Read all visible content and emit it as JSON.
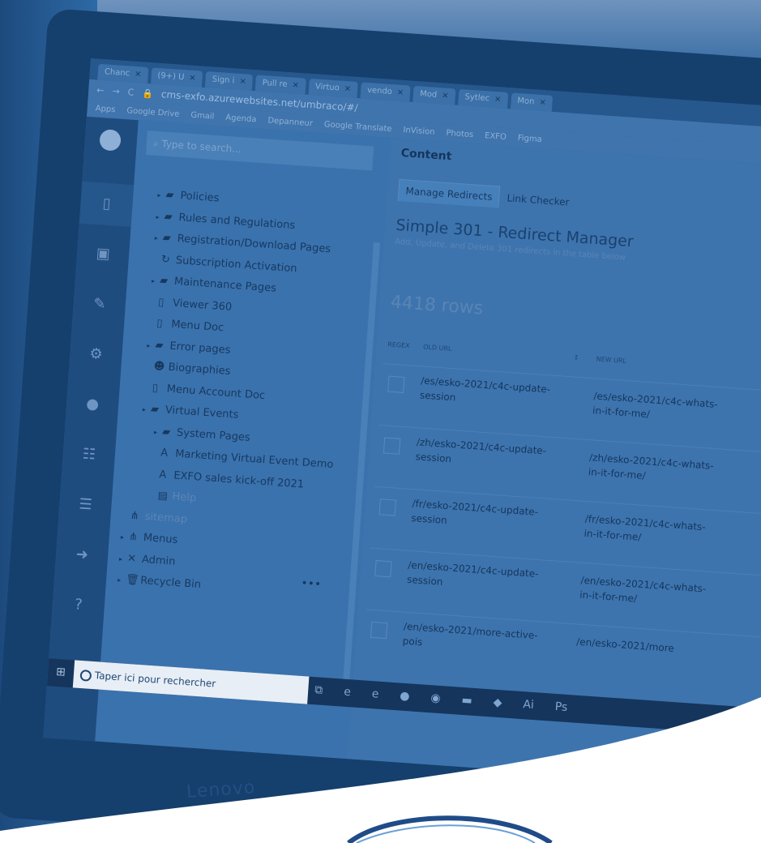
{
  "browser": {
    "tabs": [
      "Chanc",
      "(9+) U",
      "Sign i",
      "Pull re",
      "Virtuo",
      "vendo",
      "Mod",
      "Sytlec",
      "Mon"
    ],
    "url": "cms-exfo.azurewebsites.net/umbraco/#/",
    "bookmarks": [
      "Apps",
      "Google Drive",
      "Gmail",
      "Agenda",
      "Depanneur",
      "Google Translate",
      "InVision",
      "Photos",
      "EXFO",
      "Figma"
    ]
  },
  "tree": {
    "search_placeholder": "Type to search...",
    "items": [
      {
        "label": "Policies",
        "icon": "folder-icon",
        "caret": true
      },
      {
        "label": "Rules and Regulations",
        "icon": "folder-icon",
        "caret": true
      },
      {
        "label": "Registration/Download Pages",
        "icon": "folder-icon",
        "caret": true
      },
      {
        "label": "Subscription Activation",
        "icon": "refresh-icon",
        "caret": false
      },
      {
        "label": "Maintenance Pages",
        "icon": "folder-icon",
        "caret": true
      },
      {
        "label": "Viewer 360",
        "icon": "document-icon",
        "caret": false
      },
      {
        "label": "Menu Doc",
        "icon": "document-icon",
        "caret": false
      },
      {
        "label": "Error pages",
        "icon": "folder-icon",
        "caret": true
      },
      {
        "label": "Biographies",
        "icon": "users-icon",
        "caret": false
      },
      {
        "label": "Menu Account Doc",
        "icon": "document-icon",
        "caret": false
      },
      {
        "label": "Virtual Events",
        "icon": "folder-icon",
        "caret": true
      },
      {
        "label": "System Pages",
        "icon": "folder-icon",
        "caret": true
      },
      {
        "label": "Marketing Virtual Event Demo",
        "icon": "font-icon",
        "caret": false
      },
      {
        "label": "EXFO sales kick-off 2021",
        "icon": "font-icon",
        "caret": false
      },
      {
        "label": "Help",
        "icon": "book-icon",
        "caret": false
      },
      {
        "label": "sitemap",
        "icon": "sitemap-icon",
        "caret": false
      },
      {
        "label": "Menus",
        "icon": "sitemap-icon",
        "caret": true
      },
      {
        "label": "Admin",
        "icon": "tools-icon",
        "caret": true
      },
      {
        "label": "Recycle Bin",
        "icon": "trash-icon",
        "caret": true
      }
    ]
  },
  "main": {
    "header": "Content",
    "tabs": [
      "Manage Redirects",
      "Link Checker"
    ],
    "title": "Simple 301 - Redirect Manager",
    "subtitle": "Add, Update, and Delete 301 redirects in the table below",
    "row_count": "4418 rows",
    "columns": {
      "regex": "REGEX",
      "old": "OLD URL",
      "new": "NEW URL",
      "sort": "↕"
    },
    "rows": [
      {
        "old": "/es/esko-2021/c4c-update-session",
        "new": "/es/esko-2021/c4c-whats-in-it-for-me/"
      },
      {
        "old": "/zh/esko-2021/c4c-update-session",
        "new": "/zh/esko-2021/c4c-whats-in-it-for-me/"
      },
      {
        "old": "/fr/esko-2021/c4c-update-session",
        "new": "/fr/esko-2021/c4c-whats-in-it-for-me/"
      },
      {
        "old": "/en/esko-2021/c4c-update-session",
        "new": "/en/esko-2021/c4c-whats-in-it-for-me/"
      },
      {
        "old": "/en/esko-2021/more-active-pois",
        "new": "/en/esko-2021/more"
      }
    ]
  },
  "taskbar": {
    "search_text": "Taper ici pour rechercher"
  },
  "laptop_brand": "Lenovo",
  "colors": {
    "duotone_dark": "#15355c",
    "duotone_mid": "#346ba4",
    "duotone_light": "#6f93bd"
  }
}
